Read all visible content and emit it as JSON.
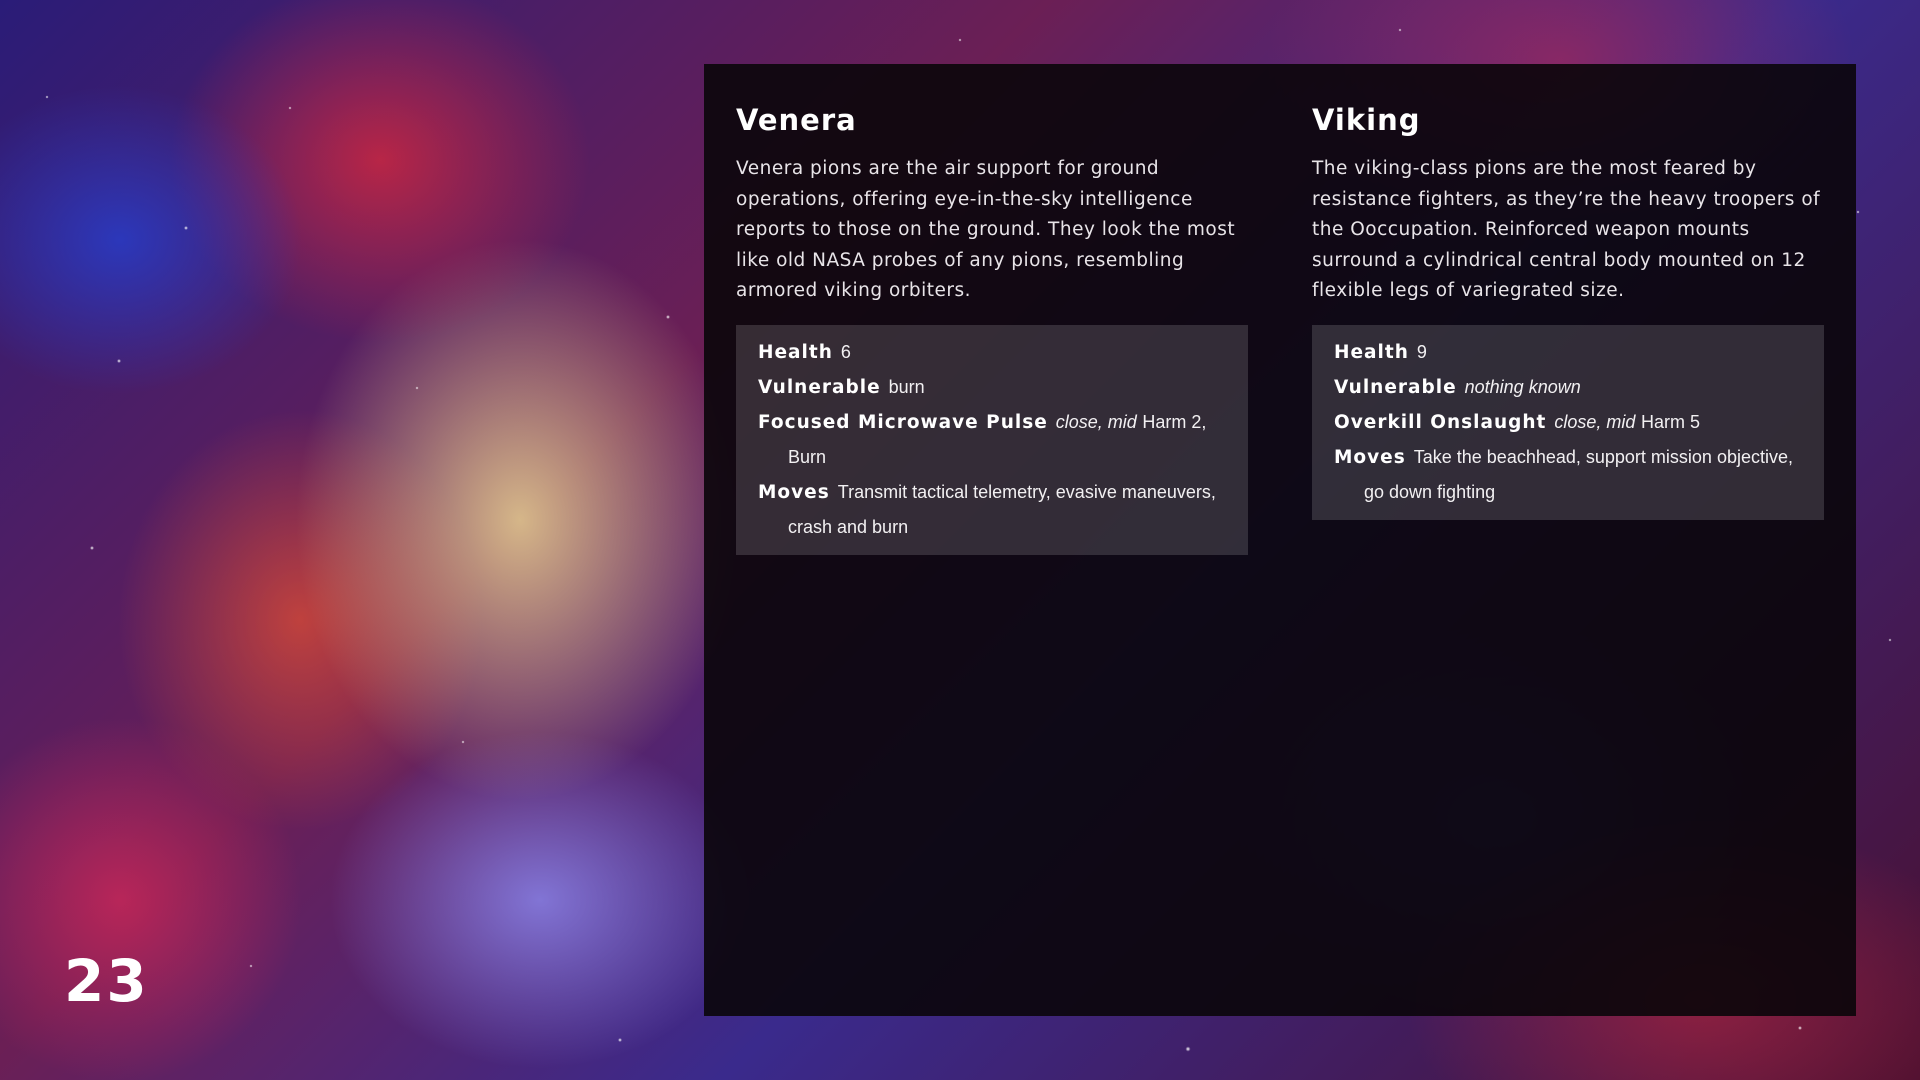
{
  "page_number": "23",
  "entries": [
    {
      "title": "Venera",
      "description": "Venera pions are the air support for ground operations, offering eye-in-the-sky intelligence reports to those on the ground. They look the most like old NASA probes of any pions, resembling armored viking orbiters.",
      "stats": {
        "health_label": "Health",
        "health_value": "6",
        "vulnerable_label": "Vulnerable",
        "vulnerable_value": "burn",
        "attack_label": "Focused Microwave Pulse",
        "attack_tags": "close, mid",
        "attack_value": "Harm 2, Burn",
        "moves_label": "Moves",
        "moves_value": "Transmit tactical telemetry, evasive maneuvers, crash and burn"
      }
    },
    {
      "title": "Viking",
      "description": "The viking-class pions are the most feared by resistance fighters, as they’re the heavy troopers of the Ooccupation. Reinforced weapon mounts surround a cylindrical central body mounted on 12 flexible legs of variegrated size.",
      "stats": {
        "health_label": "Health",
        "health_value": "9",
        "vulnerable_label": "Vulnerable",
        "vulnerable_value": "nothing known",
        "attack_label": "Overkill Onslaught",
        "attack_tags": "close, mid",
        "attack_value": "Harm 5",
        "moves_label": "Moves",
        "moves_value": "Take the beachhead, support mission objective, go down fighting"
      }
    }
  ]
}
